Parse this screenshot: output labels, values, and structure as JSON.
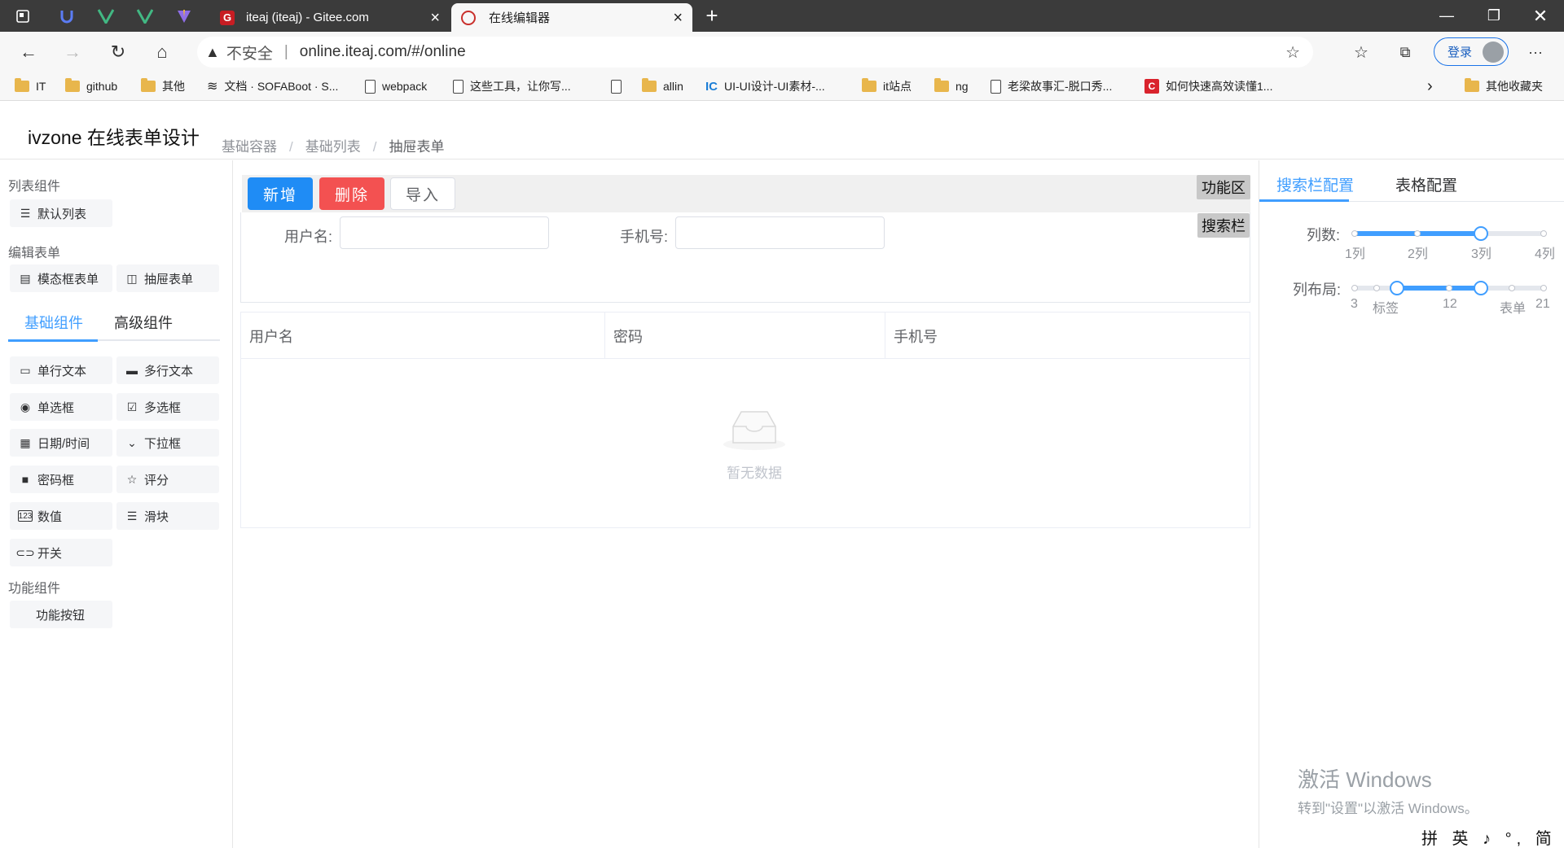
{
  "browser": {
    "tabs": [
      {
        "title": "iteaj (iteaj) - Gitee.com",
        "icon": "gitee-icon"
      },
      {
        "title": "在线编辑器",
        "icon": "editor-icon"
      }
    ],
    "new_tab": "+",
    "address": {
      "security": "不安全",
      "separator": "|",
      "url": "online.iteaj.com/#/online"
    },
    "login_label": "登录",
    "more": "···"
  },
  "bookmarks": [
    {
      "label": "IT",
      "icon": "folder"
    },
    {
      "label": "github",
      "icon": "folder"
    },
    {
      "label": "其他",
      "icon": "folder"
    },
    {
      "label": "文档 · SOFABoot · S...",
      "icon": "layers"
    },
    {
      "label": "webpack",
      "icon": "page"
    },
    {
      "label": "这些工具，让你写...",
      "icon": "page"
    },
    {
      "label": "",
      "icon": "page"
    },
    {
      "label": "allin",
      "icon": "folder"
    },
    {
      "label": "UI-UI设计-UI素材-...",
      "icon": "ic"
    },
    {
      "label": "it站点",
      "icon": "folder"
    },
    {
      "label": "ng",
      "icon": "folder"
    },
    {
      "label": "老梁故事汇-脱口秀...",
      "icon": "page"
    },
    {
      "label": "如何快速高效读懂1...",
      "icon": "red"
    }
  ],
  "bookmarks_more": "其他收藏夹",
  "app": {
    "title": "ivzone 在线表单设计",
    "breadcrumb": [
      "基础容器",
      "基础列表",
      "抽屉表单"
    ],
    "breadcrumb_sep": "/"
  },
  "left": {
    "section_list": "列表组件",
    "list_items": [
      {
        "label": "默认列表",
        "icon": "list-icon"
      }
    ],
    "section_edit": "编辑表单",
    "edit_items": [
      {
        "label": "模态框表单",
        "icon": "modal-icon"
      },
      {
        "label": "抽屉表单",
        "icon": "drawer-icon"
      }
    ],
    "tabs": [
      "基础组件",
      "高级组件"
    ],
    "basic_items": [
      {
        "label": "单行文本",
        "icon": "input-icon"
      },
      {
        "label": "多行文本",
        "icon": "textarea-icon"
      },
      {
        "label": "单选框",
        "icon": "radio-icon"
      },
      {
        "label": "多选框",
        "icon": "checkbox-icon"
      },
      {
        "label": "日期/时间",
        "icon": "calendar-icon"
      },
      {
        "label": "下拉框",
        "icon": "select-icon"
      },
      {
        "label": "密码框",
        "icon": "lock-icon"
      },
      {
        "label": "评分",
        "icon": "star-icon"
      },
      {
        "label": "数值",
        "icon": "number-icon"
      },
      {
        "label": "滑块",
        "icon": "slider-icon"
      },
      {
        "label": "开关",
        "icon": "switch-icon"
      }
    ],
    "section_func": "功能组件",
    "func_items": [
      {
        "label": "功能按钮"
      }
    ]
  },
  "center": {
    "buttons": {
      "add": "新增",
      "delete": "删除",
      "import": "导入"
    },
    "tag_func": "功能区",
    "tag_search": "搜索栏",
    "search_fields": [
      {
        "label": "用户名:",
        "value": ""
      },
      {
        "label": "手机号:",
        "value": ""
      }
    ],
    "table_columns": [
      "用户名",
      "密码",
      "手机号"
    ],
    "empty_text": "暂无数据"
  },
  "right": {
    "tabs": [
      "搜索栏配置",
      "表格配置"
    ],
    "columns_label": "列数:",
    "columns_marks": [
      "1列",
      "2列",
      "3列",
      "4列"
    ],
    "columns_value": 3,
    "layout_label": "列布局:",
    "layout_marks": [
      "3",
      "标签",
      "12",
      "表单",
      "21"
    ],
    "layout_range": [
      6,
      15
    ]
  },
  "watermark": {
    "line1": "激活 Windows",
    "line2": "转到\"设置\"以激活 Windows。"
  },
  "ime": "拼 英 ♪ °, 简 ⚙ :"
}
